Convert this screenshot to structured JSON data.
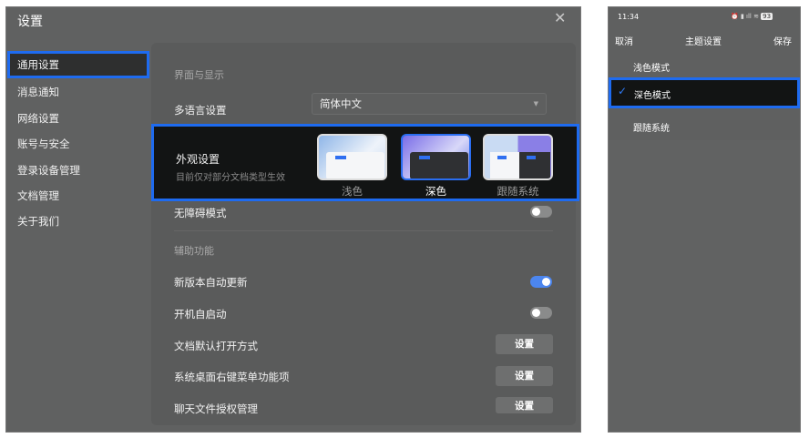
{
  "settings": {
    "title": "设置",
    "close_icon": "close-icon",
    "sidebar": [
      {
        "label": "通用设置",
        "active": true
      },
      {
        "label": "消息通知"
      },
      {
        "label": "网络设置"
      },
      {
        "label": "账号与安全"
      },
      {
        "label": "登录设备管理"
      },
      {
        "label": "文档管理"
      },
      {
        "label": "关于我们"
      }
    ],
    "section_display": "界面与显示",
    "language_label": "多语言设置",
    "language_value": "简体中文",
    "appearance": {
      "label": "外观设置",
      "desc": "目前仅对部分文档类型生效",
      "options": [
        "浅色",
        "深色",
        "跟随系统"
      ],
      "selected": "深色"
    },
    "accessibility_mode": {
      "label": "无障碍模式",
      "on": false
    },
    "section_aux": "辅助功能",
    "auto_update": {
      "label": "新版本自动更新",
      "on": true
    },
    "auto_start": {
      "label": "开机自启动",
      "on": false
    },
    "rows": [
      {
        "label": "文档默认打开方式",
        "button": "设置"
      },
      {
        "label": "系统桌面右键菜单功能项",
        "button": "设置"
      },
      {
        "label": "聊天文件授权管理",
        "button": "设置"
      }
    ]
  },
  "phone": {
    "time": "11:34",
    "battery": "93",
    "cancel": "取消",
    "title": "主题设置",
    "save": "保存",
    "options": [
      "浅色模式",
      "深色模式",
      "跟随系统"
    ],
    "selected": "深色模式"
  },
  "colors": {
    "accent": "#1e6bf0",
    "toggle_on": "#4c86ef"
  }
}
